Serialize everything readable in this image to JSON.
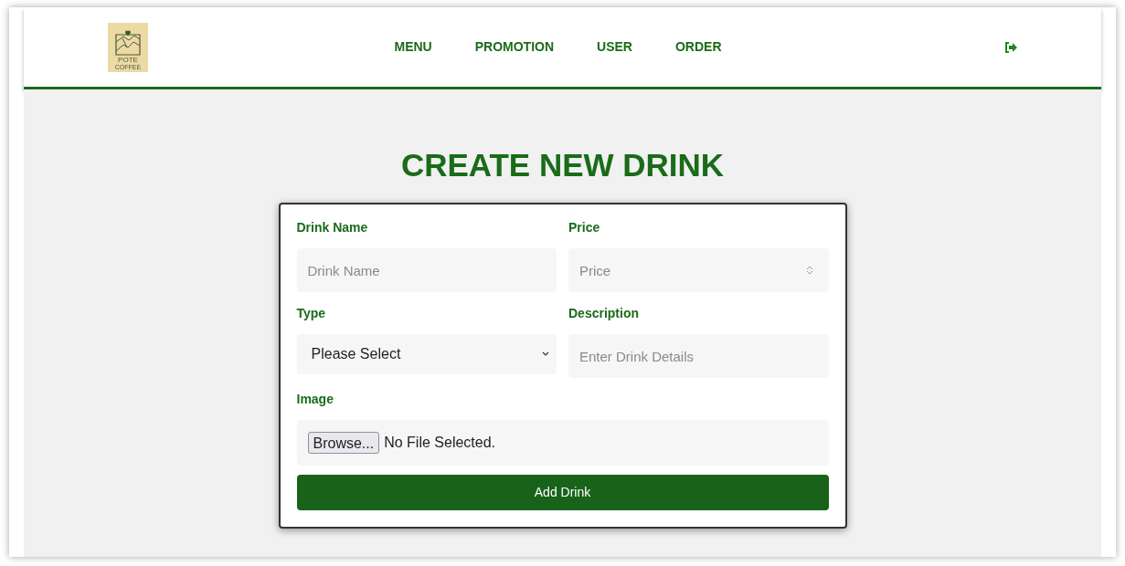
{
  "logo": {
    "name": "POTE",
    "tagline": "COFFEE"
  },
  "nav": [
    {
      "label": "MENU"
    },
    {
      "label": "PROMOTION"
    },
    {
      "label": "USER"
    },
    {
      "label": "ORDER"
    }
  ],
  "title": "CREATE NEW DRINK",
  "form": {
    "fields": [
      {
        "kind": "text",
        "label": "Drink Name",
        "placeholder": "Drink Name"
      },
      {
        "kind": "number",
        "label": "Price",
        "placeholder": "Price"
      },
      {
        "kind": "select",
        "label": "Type",
        "value": "Please Select"
      },
      {
        "kind": "text",
        "label": "Description",
        "placeholder": "Enter Drink Details"
      },
      {
        "kind": "file",
        "label": "Image",
        "button": "Browse...",
        "value": "No File Selected."
      }
    ],
    "submit": "Add Drink"
  }
}
